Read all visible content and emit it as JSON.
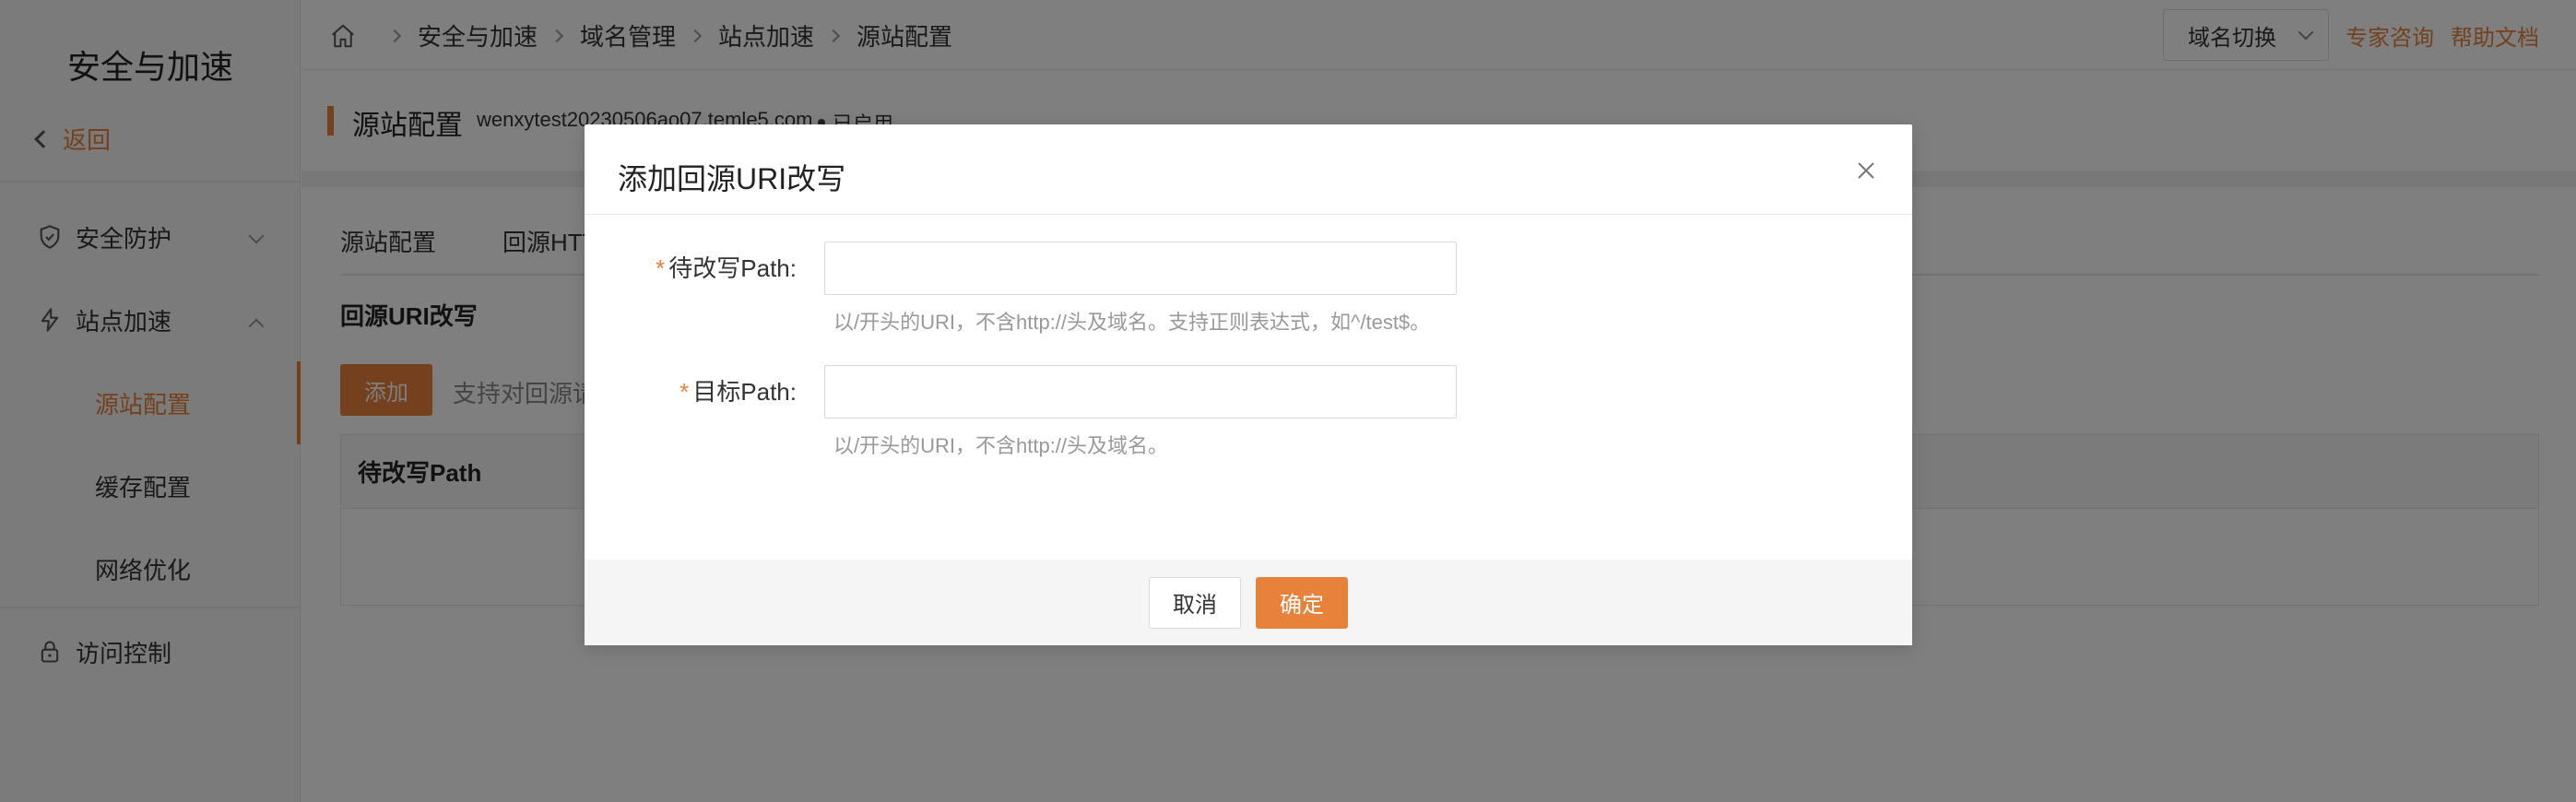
{
  "sidebar": {
    "title": "安全与加速",
    "back_label": "返回",
    "items": [
      {
        "label": "安全防护",
        "icon": "shield-icon",
        "expanded": false
      },
      {
        "label": "站点加速",
        "icon": "lightning-icon",
        "expanded": true
      },
      {
        "label": "访问控制",
        "icon": "lock-icon",
        "expanded": false
      }
    ],
    "subitems": [
      {
        "label": "源站配置",
        "active": true
      },
      {
        "label": "缓存配置",
        "active": false
      },
      {
        "label": "网络优化",
        "active": false
      }
    ]
  },
  "topbar": {
    "breadcrumb": [
      "安全与加速",
      "域名管理",
      "站点加速",
      "源站配置"
    ],
    "domain_switch": "域名切换",
    "links": [
      "专家咨询",
      "帮助文档"
    ]
  },
  "page_header": {
    "title": "源站配置",
    "domain": "wenxytest20230506ao07.temle5.com",
    "status": "已启用"
  },
  "content": {
    "tabs": [
      "源站配置",
      "回源HTT"
    ],
    "section_title": "回源URI改写",
    "add_label": "添加",
    "add_hint": "支持对回源请",
    "table_header": "待改写Path"
  },
  "modal": {
    "title": "添加回源URI改写",
    "fields": [
      {
        "label": "待改写Path:",
        "required_mark": "*",
        "value": "",
        "help": "以/开头的URI，不含http://头及域名。支持正则表达式，如^/test$。"
      },
      {
        "label": "目标Path:",
        "required_mark": "*",
        "value": "",
        "help": "以/开头的URI，不含http://头及域名。"
      }
    ],
    "cancel_label": "取消",
    "ok_label": "确定"
  },
  "colors": {
    "accent": "#e8813a",
    "mask": "rgba(0,0,0,0.5)"
  }
}
